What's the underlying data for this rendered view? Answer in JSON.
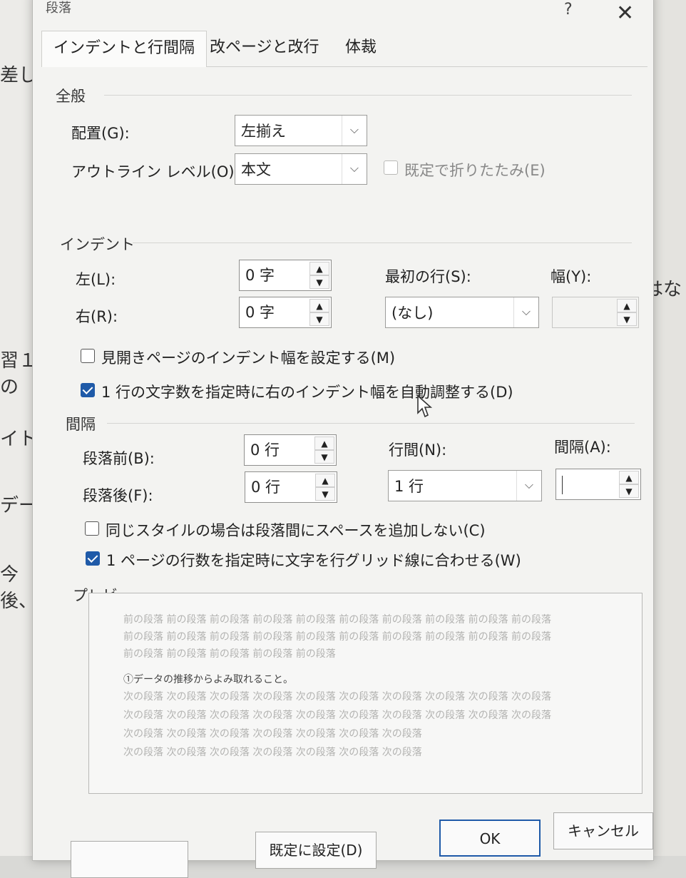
{
  "background": {
    "left_texts": [
      "差し",
      "習１の",
      "イト",
      "デー",
      "今後、"
    ],
    "right_text": "はな"
  },
  "dialog": {
    "title": "段落",
    "help_label": "?",
    "close_label": "✕",
    "tabs": [
      "インデントと行間隔",
      "改ページと改行",
      "体裁"
    ],
    "general": {
      "title": "全般",
      "alignment_label": "配置(G):",
      "alignment_value": "左揃え",
      "outline_label": "アウトライン レベル(O):",
      "outline_value": "本文",
      "collapse_label": "既定で折りたたみ(E)"
    },
    "indent": {
      "title": "インデント",
      "left_label": "左(L):",
      "left_value": "0 字",
      "right_label": "右(R):",
      "right_value": "0 字",
      "first_line_label": "最初の行(S):",
      "first_line_value": "(なし)",
      "width_label": "幅(Y):",
      "mirror_label": "見開きページのインデント幅を設定する(M)",
      "mirror_checked": false,
      "auto_adjust_label": "1 行の文字数を指定時に右のインデント幅を自動調整する(D)",
      "auto_adjust_checked": true
    },
    "spacing": {
      "title": "間隔",
      "before_label": "段落前(B):",
      "before_value": "0 行",
      "after_label": "段落後(F):",
      "after_value": "0 行",
      "line_spacing_label": "行間(N):",
      "line_spacing_value": "1 行",
      "at_label": "間隔(A):",
      "no_space_label": "同じスタイルの場合は段落間にスペースを追加しない(C)",
      "no_space_checked": false,
      "snap_grid_label": "1 ページの行数を指定時に文字を行グリッド線に合わせる(W)",
      "snap_grid_checked": true
    },
    "preview": {
      "title": "プレビュー",
      "prev_lines": [
        "前の段落 前の段落 前の段落 前の段落 前の段落 前の段落 前の段落 前の段落 前の段落 前の段落",
        "前の段落 前の段落 前の段落 前の段落 前の段落 前の段落 前の段落 前の段落 前の段落 前の段落",
        "前の段落 前の段落 前の段落 前の段落 前の段落"
      ],
      "main_line": "①データの推移からよみ取れること。",
      "next_lines": [
        "次の段落 次の段落 次の段落 次の段落 次の段落 次の段落 次の段落 次の段落 次の段落 次の段落",
        "次の段落 次の段落 次の段落 次の段落 次の段落 次の段落 次の段落 次の段落 次の段落 次の段落",
        "次の段落 次の段落 次の段落 次の段落 次の段落 次の段落 次の段落",
        "次の段落 次の段落 次の段落 次の段落 次の段落 次の段落 次の段落"
      ]
    },
    "buttons": {
      "set_default": "既定に設定(D)",
      "ok": "OK",
      "cancel": "キャンセル"
    }
  },
  "colors": {
    "accent": "#1f5aa8",
    "dialog_bg": "#f3f3f1"
  }
}
